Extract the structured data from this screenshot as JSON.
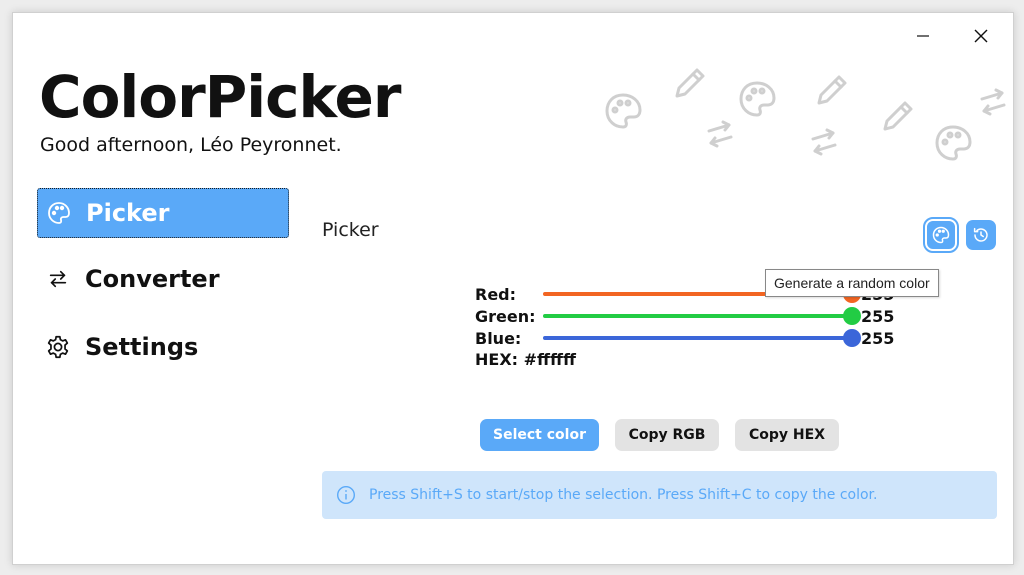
{
  "app": {
    "title": "ColorPicker",
    "greeting": "Good afternoon, Léo Peyronnet."
  },
  "titlebar": {
    "minimize_icon": "minimize-icon",
    "close_icon": "close-icon"
  },
  "nav": {
    "items": [
      {
        "label": "Picker",
        "icon": "palette-icon",
        "active": true
      },
      {
        "label": "Converter",
        "icon": "arrows-icon",
        "active": false
      },
      {
        "label": "Settings",
        "icon": "gear-icon",
        "active": false
      }
    ]
  },
  "picker": {
    "title": "Picker",
    "tooltip": "Generate a random color",
    "sliders": [
      {
        "label": "Red:",
        "value": "255",
        "color": "#f26522"
      },
      {
        "label": "Green:",
        "value": "255",
        "color": "#22cc44"
      },
      {
        "label": "Blue:",
        "value": "255",
        "color": "#3b66d9"
      }
    ],
    "hex_label": "HEX: #ffffff",
    "buttons": {
      "select": "Select color",
      "copy_rgb": "Copy RGB",
      "copy_hex": "Copy HEX"
    },
    "info": "Press Shift+S to start/stop the selection. Press Shift+C to copy the color."
  },
  "colors": {
    "accent": "#5aa9f8",
    "info_bg": "#cfe5fb"
  }
}
